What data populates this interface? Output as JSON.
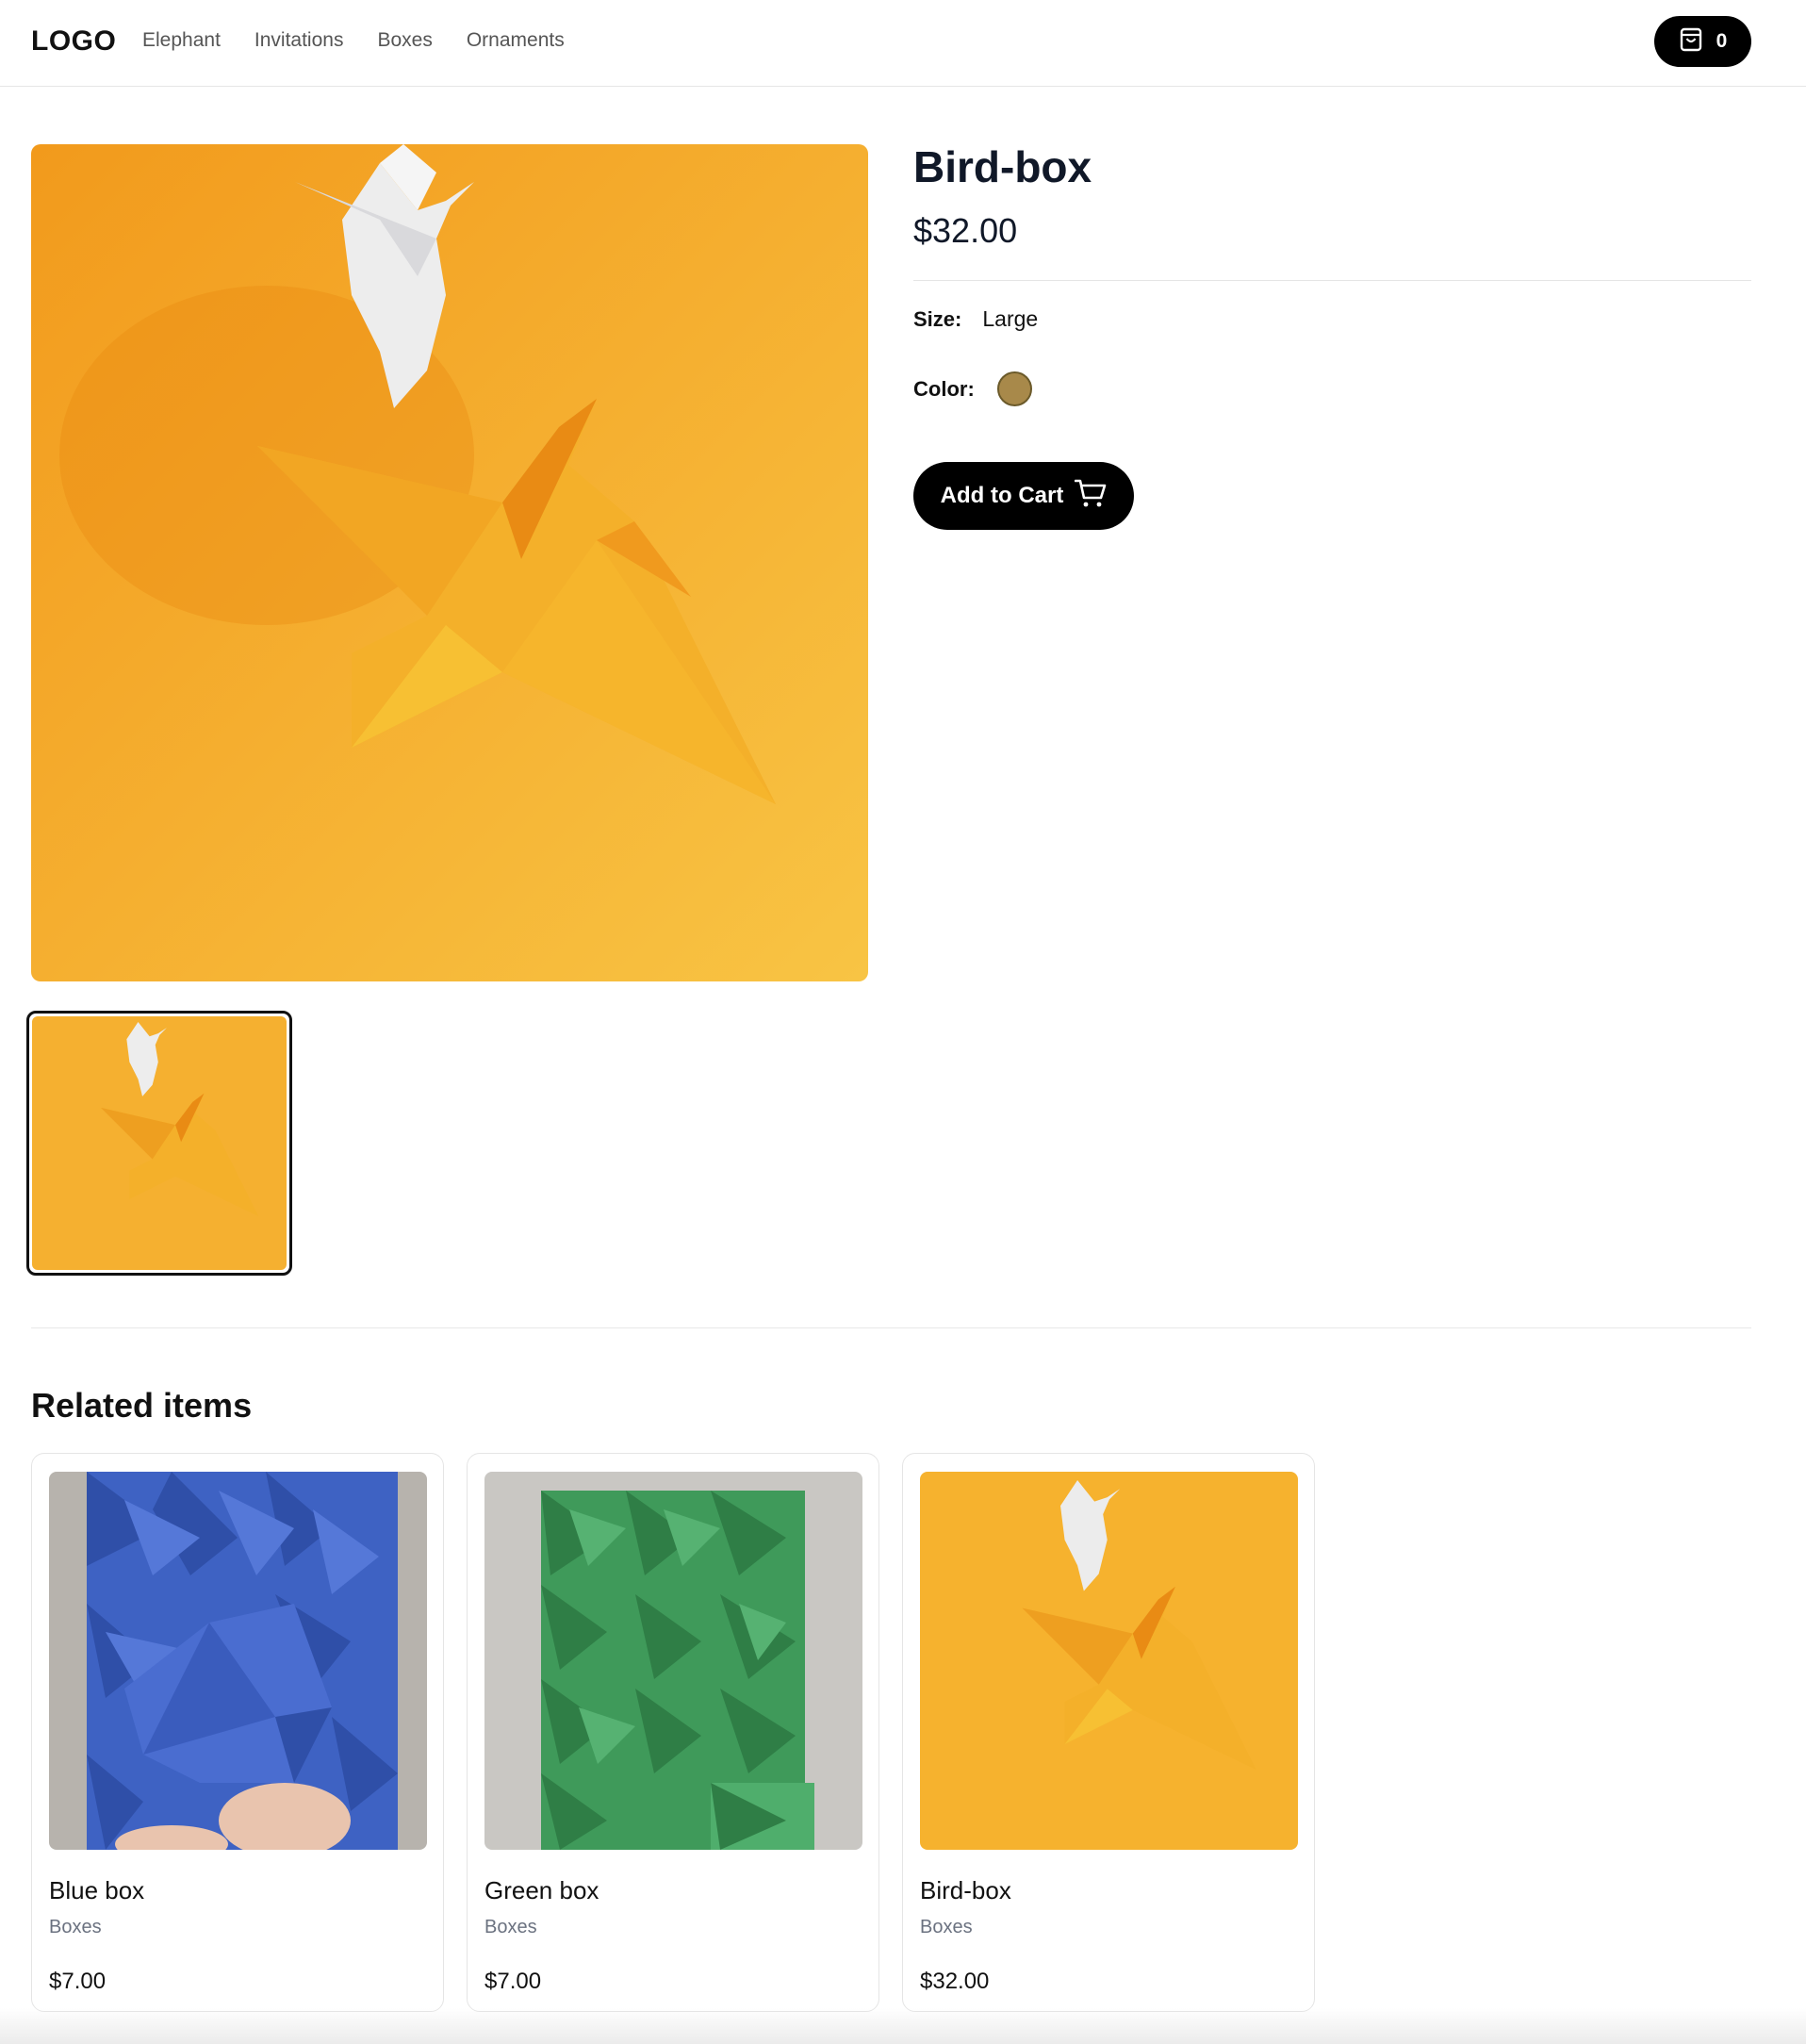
{
  "header": {
    "logo": "LOGO",
    "nav": [
      "Elephant",
      "Invitations",
      "Boxes",
      "Ornaments"
    ],
    "cart_count": "0"
  },
  "product": {
    "title": "Bird-box",
    "price": "$32.00",
    "size_label": "Size:",
    "size_value": "Large",
    "color_label": "Color:",
    "color_swatch": "#a8894a",
    "add_to_cart": "Add to Cart"
  },
  "related": {
    "heading": "Related items",
    "items": [
      {
        "name": "Blue box",
        "category": "Boxes",
        "price": "$7.00"
      },
      {
        "name": "Green box",
        "category": "Boxes",
        "price": "$7.00"
      },
      {
        "name": "Bird-box",
        "category": "Boxes",
        "price": "$32.00"
      }
    ]
  },
  "colors": {
    "accent": "#000000",
    "bird_box_background": "#f7b52e",
    "blue_box": "#3f63c4",
    "green_box": "#3f9a5a"
  },
  "icons": {
    "cart_button": "shopping-bag-icon",
    "add_to_cart": "shopping-cart-icon"
  }
}
